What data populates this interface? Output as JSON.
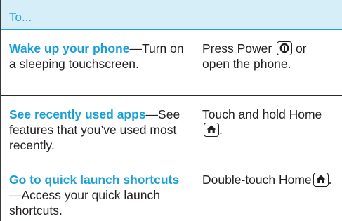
{
  "header": {
    "label": "To..."
  },
  "rows": [
    {
      "title": "Wake up your phone",
      "desc": "—Turn on a sleeping touchscreen.",
      "action_text": "Press Power",
      "action_suffix": " or open the phone.",
      "icon": "power-icon"
    },
    {
      "title": "See recently used apps",
      "desc": "—See features that you’ve used most recently.",
      "action_text": "Touch and hold Home",
      "action_suffix": ".",
      "icon": "home-icon"
    },
    {
      "title": "Go to quick launch shortcuts",
      "desc": "—Access your quick launch shortcuts.",
      "action_text": "Double-touch Home",
      "action_suffix": ".",
      "icon": "home-icon"
    }
  ],
  "colors": {
    "header_bg": "#d5eef8",
    "accent": "#1a9fd8",
    "text": "#231f20"
  }
}
